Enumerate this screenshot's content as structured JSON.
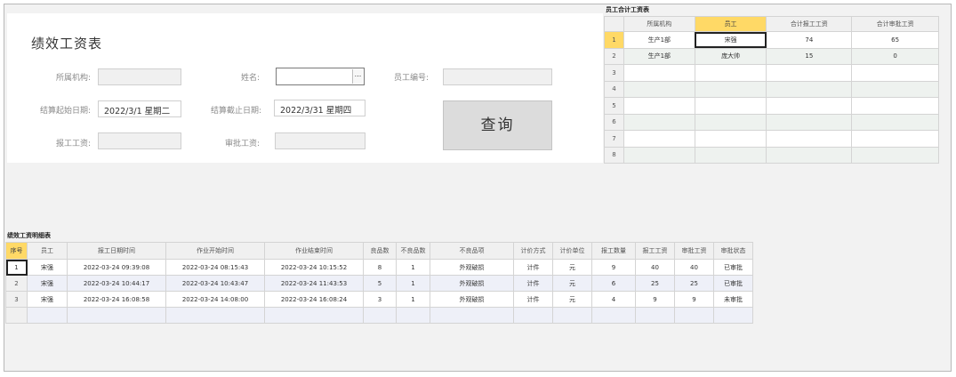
{
  "form": {
    "title": "绩效工资表",
    "org_label": "所属机构:",
    "org_value": "",
    "name_label": "姓名:",
    "name_value": "",
    "name_btn": "...",
    "empno_label": "员工编号:",
    "empno_value": "",
    "start_label": "结算起始日期:",
    "start_value": "2022/3/1  星期二",
    "end_label": "结算截止日期:",
    "end_value": "2022/3/31  星期四",
    "report_label": "报工工资:",
    "report_value": "",
    "approve_label": "审批工资:",
    "approve_value": "",
    "query_label": "查询"
  },
  "summary": {
    "title": "员工合计工资表",
    "columns": [
      "所属机构",
      "员工",
      "合计报工工资",
      "合计审批工资"
    ],
    "rows": [
      {
        "n": "1",
        "org": "生产1部",
        "emp": "宋强",
        "report": "74",
        "approve": "65"
      },
      {
        "n": "2",
        "org": "生产1部",
        "emp": "庞大帅",
        "report": "15",
        "approve": "0"
      },
      {
        "n": "3",
        "org": "",
        "emp": "",
        "report": "",
        "approve": ""
      },
      {
        "n": "4",
        "org": "",
        "emp": "",
        "report": "",
        "approve": ""
      },
      {
        "n": "5",
        "org": "",
        "emp": "",
        "report": "",
        "approve": ""
      },
      {
        "n": "6",
        "org": "",
        "emp": "",
        "report": "",
        "approve": ""
      },
      {
        "n": "7",
        "org": "",
        "emp": "",
        "report": "",
        "approve": ""
      },
      {
        "n": "8",
        "org": "",
        "emp": "",
        "report": "",
        "approve": ""
      }
    ]
  },
  "detail": {
    "title": "绩效工资明细表",
    "columns": [
      "序号",
      "员工",
      "报工日期时间",
      "作业开始时间",
      "作业结束时间",
      "良品数",
      "不良品数",
      "不良品项",
      "计价方式",
      "计价单位",
      "报工数量",
      "报工工资",
      "审批工资",
      "审批状态"
    ],
    "rows": [
      [
        "1",
        "宋强",
        "2022-03-24 09:39:08",
        "2022-03-24 08:15:43",
        "2022-03-24 10:15:52",
        "8",
        "1",
        "外观破损",
        "计件",
        "元",
        "9",
        "40",
        "40",
        "已审批"
      ],
      [
        "2",
        "宋强",
        "2022-03-24 10:44:17",
        "2022-03-24 10:43:47",
        "2022-03-24 11:43:53",
        "5",
        "1",
        "外观破损",
        "计件",
        "元",
        "6",
        "25",
        "25",
        "已审批"
      ],
      [
        "3",
        "宋强",
        "2022-03-24 16:08:58",
        "2022-03-24 14:08:00",
        "2022-03-24 16:08:24",
        "3",
        "1",
        "外观破损",
        "计件",
        "元",
        "4",
        "9",
        "9",
        "未审批"
      ],
      [
        "",
        "",
        "",
        "",
        "",
        "",
        "",
        "",
        "",
        "",
        "",
        "",
        "",
        ""
      ]
    ]
  }
}
